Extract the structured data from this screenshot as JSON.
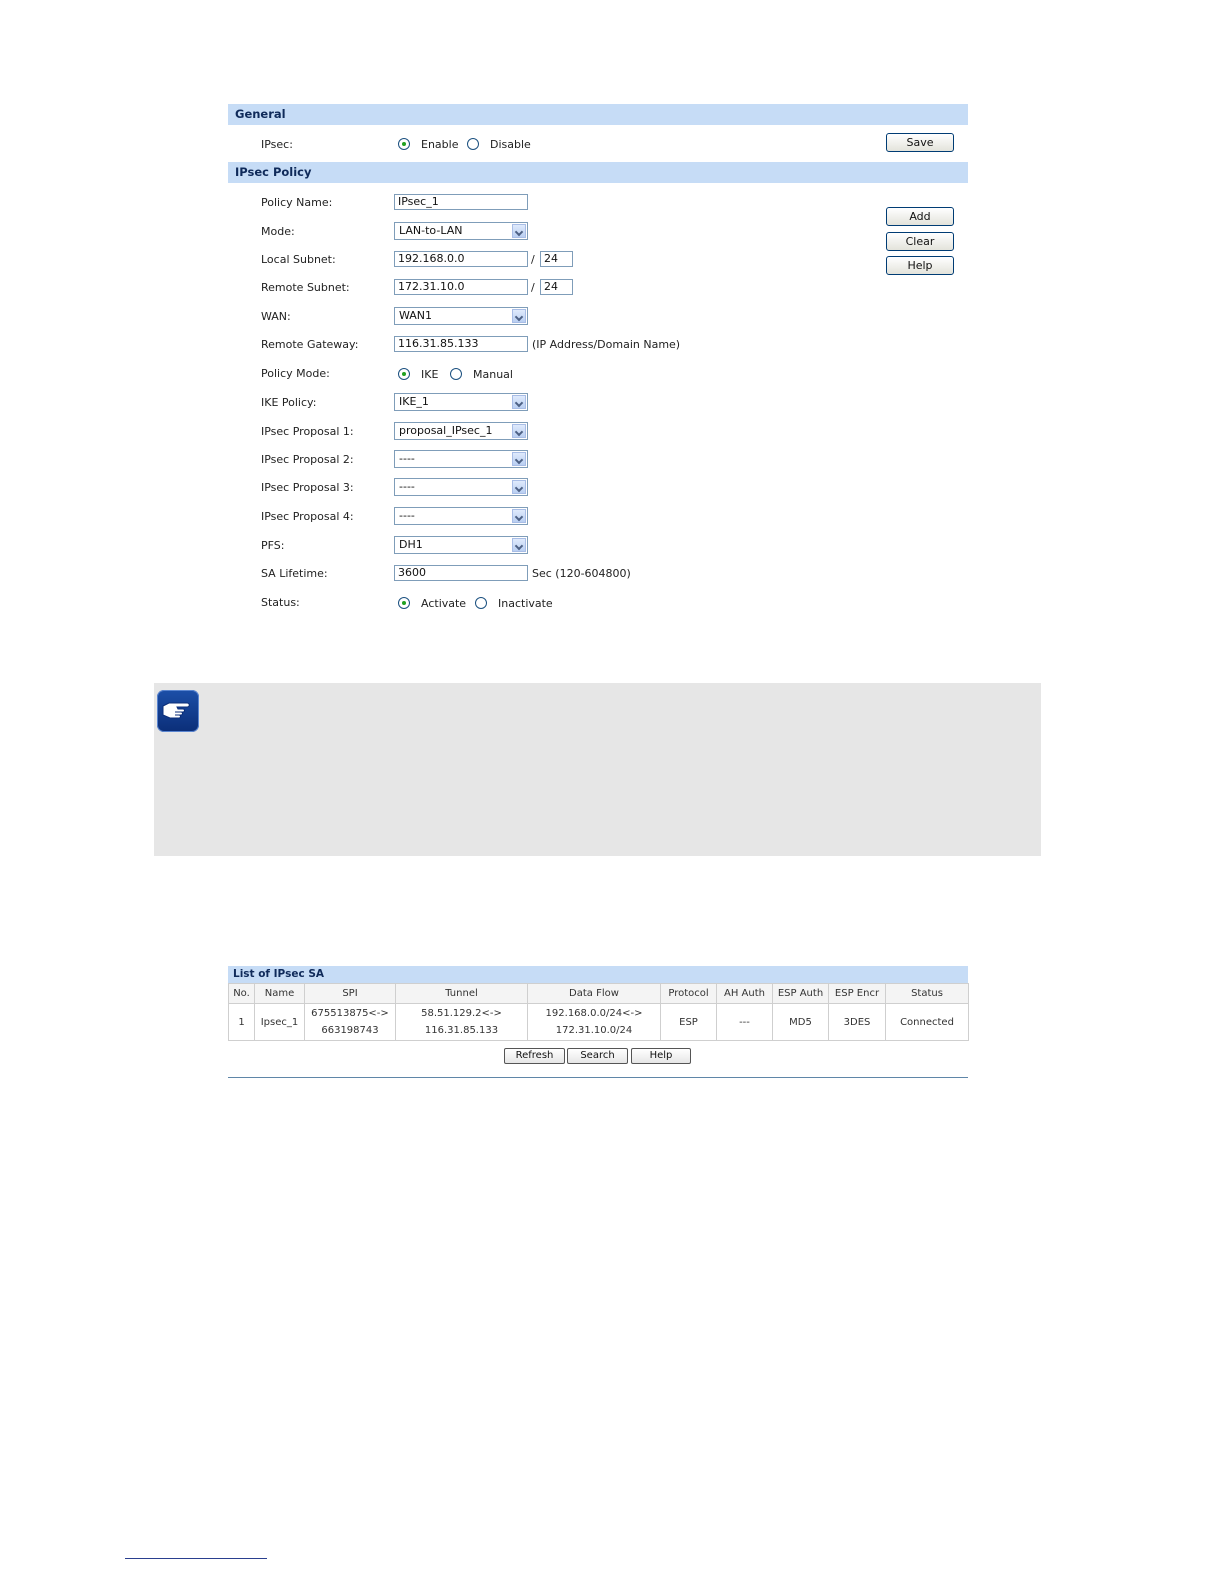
{
  "general": {
    "title": "General",
    "ipsec_label": "IPsec:",
    "enable_label": "Enable",
    "disable_label": "Disable",
    "save_label": "Save"
  },
  "policy": {
    "title": "IPsec Policy",
    "buttons": {
      "add": "Add",
      "clear": "Clear",
      "help": "Help"
    },
    "policy_name_label": "Policy Name:",
    "policy_name_value": "IPsec_1",
    "mode_label": "Mode:",
    "mode_value": "LAN-to-LAN",
    "local_subnet_label": "Local Subnet:",
    "local_subnet_value": "192.168.0.0",
    "local_mask_value": "24",
    "remote_subnet_label": "Remote Subnet:",
    "remote_subnet_value": "172.31.10.0",
    "remote_mask_value": "24",
    "slash": "/",
    "wan_label": "WAN:",
    "wan_value": "WAN1",
    "remote_gateway_label": "Remote Gateway:",
    "remote_gateway_value": "116.31.85.133",
    "remote_gateway_hint": "(IP Address/Domain Name)",
    "policy_mode_label": "Policy Mode:",
    "ike_label": "IKE",
    "manual_label": "Manual",
    "ike_policy_label": "IKE Policy:",
    "ike_policy_value": "IKE_1",
    "proposal1_label": "IPsec Proposal 1:",
    "proposal1_value": "proposal_IPsec_1",
    "proposal2_label": "IPsec Proposal 2:",
    "proposal2_value": "----",
    "proposal3_label": "IPsec Proposal 3:",
    "proposal3_value": "----",
    "proposal4_label": "IPsec Proposal 4:",
    "proposal4_value": "----",
    "pfs_label": "PFS:",
    "pfs_value": "DH1",
    "sa_lifetime_label": "SA Lifetime:",
    "sa_lifetime_value": "3600",
    "sa_lifetime_hint": "Sec (120-604800)",
    "status_label": "Status:",
    "activate_label": "Activate",
    "inactivate_label": "Inactivate"
  },
  "note": {
    "icon": "pointing-hand-icon"
  },
  "sa_list": {
    "title": "List of IPsec SA",
    "columns": [
      "No.",
      "Name",
      "SPI",
      "Tunnel",
      "Data Flow",
      "Protocol",
      "AH Auth",
      "ESP Auth",
      "ESP Encr",
      "Status"
    ],
    "rows": [
      {
        "no": "1",
        "name": "Ipsec_1",
        "spi_line1": "675513875<->",
        "spi_line2": "663198743",
        "tunnel_line1": "58.51.129.2<->",
        "tunnel_line2": "116.31.85.133",
        "flow_line1": "192.168.0.0/24<->",
        "flow_line2": "172.31.10.0/24",
        "protocol": "ESP",
        "ah_auth": "---",
        "esp_auth": "MD5",
        "esp_encr": "3DES",
        "status": "Connected"
      }
    ],
    "buttons": {
      "refresh": "Refresh",
      "search": "Search",
      "help": "Help"
    }
  }
}
